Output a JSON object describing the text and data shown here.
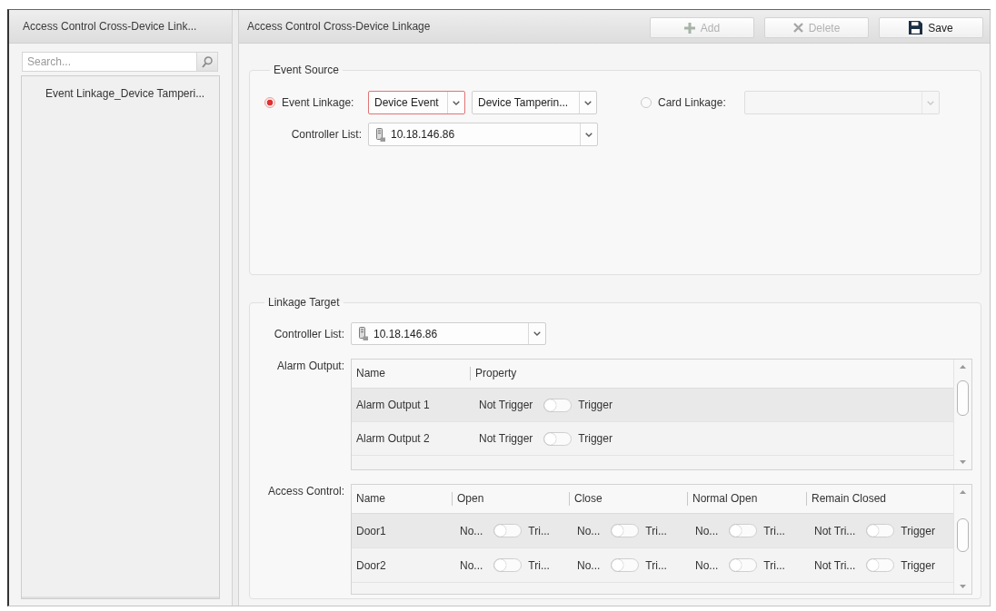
{
  "sidebar": {
    "title": "Access Control Cross-Device Link...",
    "search": {
      "placeholder": "Search..."
    },
    "items": [
      {
        "label": "Event Linkage_Device Tamperi...",
        "selected": false
      }
    ]
  },
  "main": {
    "title": "Access Control Cross-Device Linkage",
    "buttons": [
      {
        "label": "Add",
        "kind": "add",
        "disabled": true
      },
      {
        "label": "Delete",
        "kind": "delete",
        "disabled": true
      },
      {
        "label": "Save",
        "kind": "save",
        "disabled": false
      }
    ]
  },
  "event_source": {
    "title": "Event Source",
    "options": [
      {
        "label": "Event Linkage:",
        "selected": true,
        "fields": [
          {
            "value": "Device Event",
            "highlighted": true,
            "disabled": false
          },
          {
            "value": "Device Tamperin...",
            "highlighted": false,
            "disabled": false
          }
        ]
      },
      {
        "label": "Card Linkage:",
        "selected": false,
        "fields": [
          {
            "highlighted": false,
            "disabled": true
          }
        ]
      }
    ],
    "controller_list": {
      "label": "Controller List:",
      "value": "10.18.146.86"
    }
  },
  "linkage_target": {
    "title": "Linkage Target",
    "controller_list": {
      "label": "Controller List:",
      "value": "10.18.146.86"
    },
    "alarm_output": {
      "label": "Alarm Output:",
      "columns": [
        "Name",
        "Property"
      ],
      "rows": [
        {
          "name": "Alarm Output 1",
          "triggers": [
            {
              "off_label": "Not Trigger",
              "on_label": "Trigger",
              "on": false
            }
          ]
        },
        {
          "name": "Alarm Output 2",
          "triggers": [
            {
              "off_label": "Not Trigger",
              "on_label": "Trigger",
              "on": false
            }
          ]
        }
      ]
    },
    "access_control": {
      "label": "Access Control:",
      "columns": [
        "Name",
        "Open",
        "Close",
        "Normal Open",
        "Remain Closed"
      ],
      "rows": [
        {
          "name": "Door1",
          "triggers": [
            {
              "off_label": "No...",
              "on_label": "Tri...",
              "on": false
            },
            {
              "off_label": "No...",
              "on_label": "Tri...",
              "on": false
            },
            {
              "off_label": "No...",
              "on_label": "Tri...",
              "on": false
            },
            {
              "off_label": "Not Tri...",
              "on_label": "Trigger",
              "on": false
            }
          ]
        },
        {
          "name": "Door2",
          "triggers": [
            {
              "off_label": "No...",
              "on_label": "Tri...",
              "on": false
            },
            {
              "off_label": "No...",
              "on_label": "Tri...",
              "on": false
            },
            {
              "off_label": "No...",
              "on_label": "Tri...",
              "on": false
            },
            {
              "off_label": "Not Tri...",
              "on_label": "Trigger",
              "on": false
            }
          ]
        }
      ]
    }
  }
}
